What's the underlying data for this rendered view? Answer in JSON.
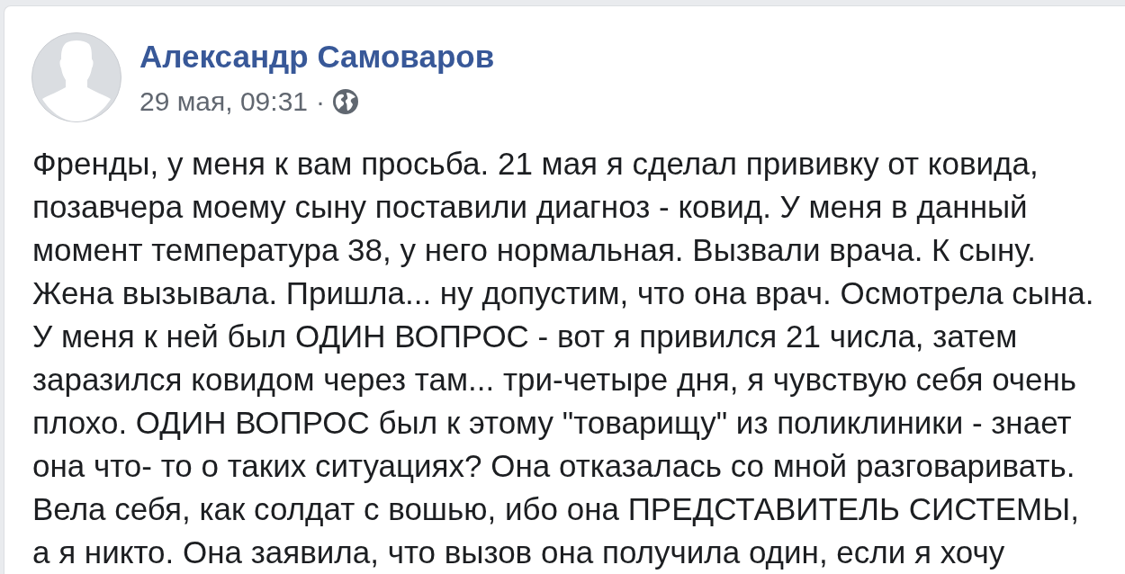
{
  "post": {
    "author": {
      "name": "Александр Самоваров"
    },
    "timestamp": "29 мая, 09:31",
    "separator": "·",
    "text": "Френды, у меня к вам просьба. 21 мая я сделал прививку от ковида, позавчера моему сыну поставили диагноз - ковид. У меня в данный момент температура 38, у него нормальная. Вызвали врача. К сыну. Жена вызывала. Пришла... ну допустим, что она врач. Осмотрела сына. У меня к ней был ОДИН ВОПРОС - вот я привился 21 числа, затем заразился ковидом через там... три-четыре дня, я чувствую себя очень плохо. ОДИН ВОПРОС был к этому \"товарищу\" из поликлиники - знает она что- то о таких ситуациях? Она отказалась со мной разговаривать. Вела себя, как солдат с вошью, ибо она ПРЕДСТАВИТЕЛЬ СИСТЕМЫ, а я никто. Она заявила, что вызов она получила один, если я хочу"
  }
}
